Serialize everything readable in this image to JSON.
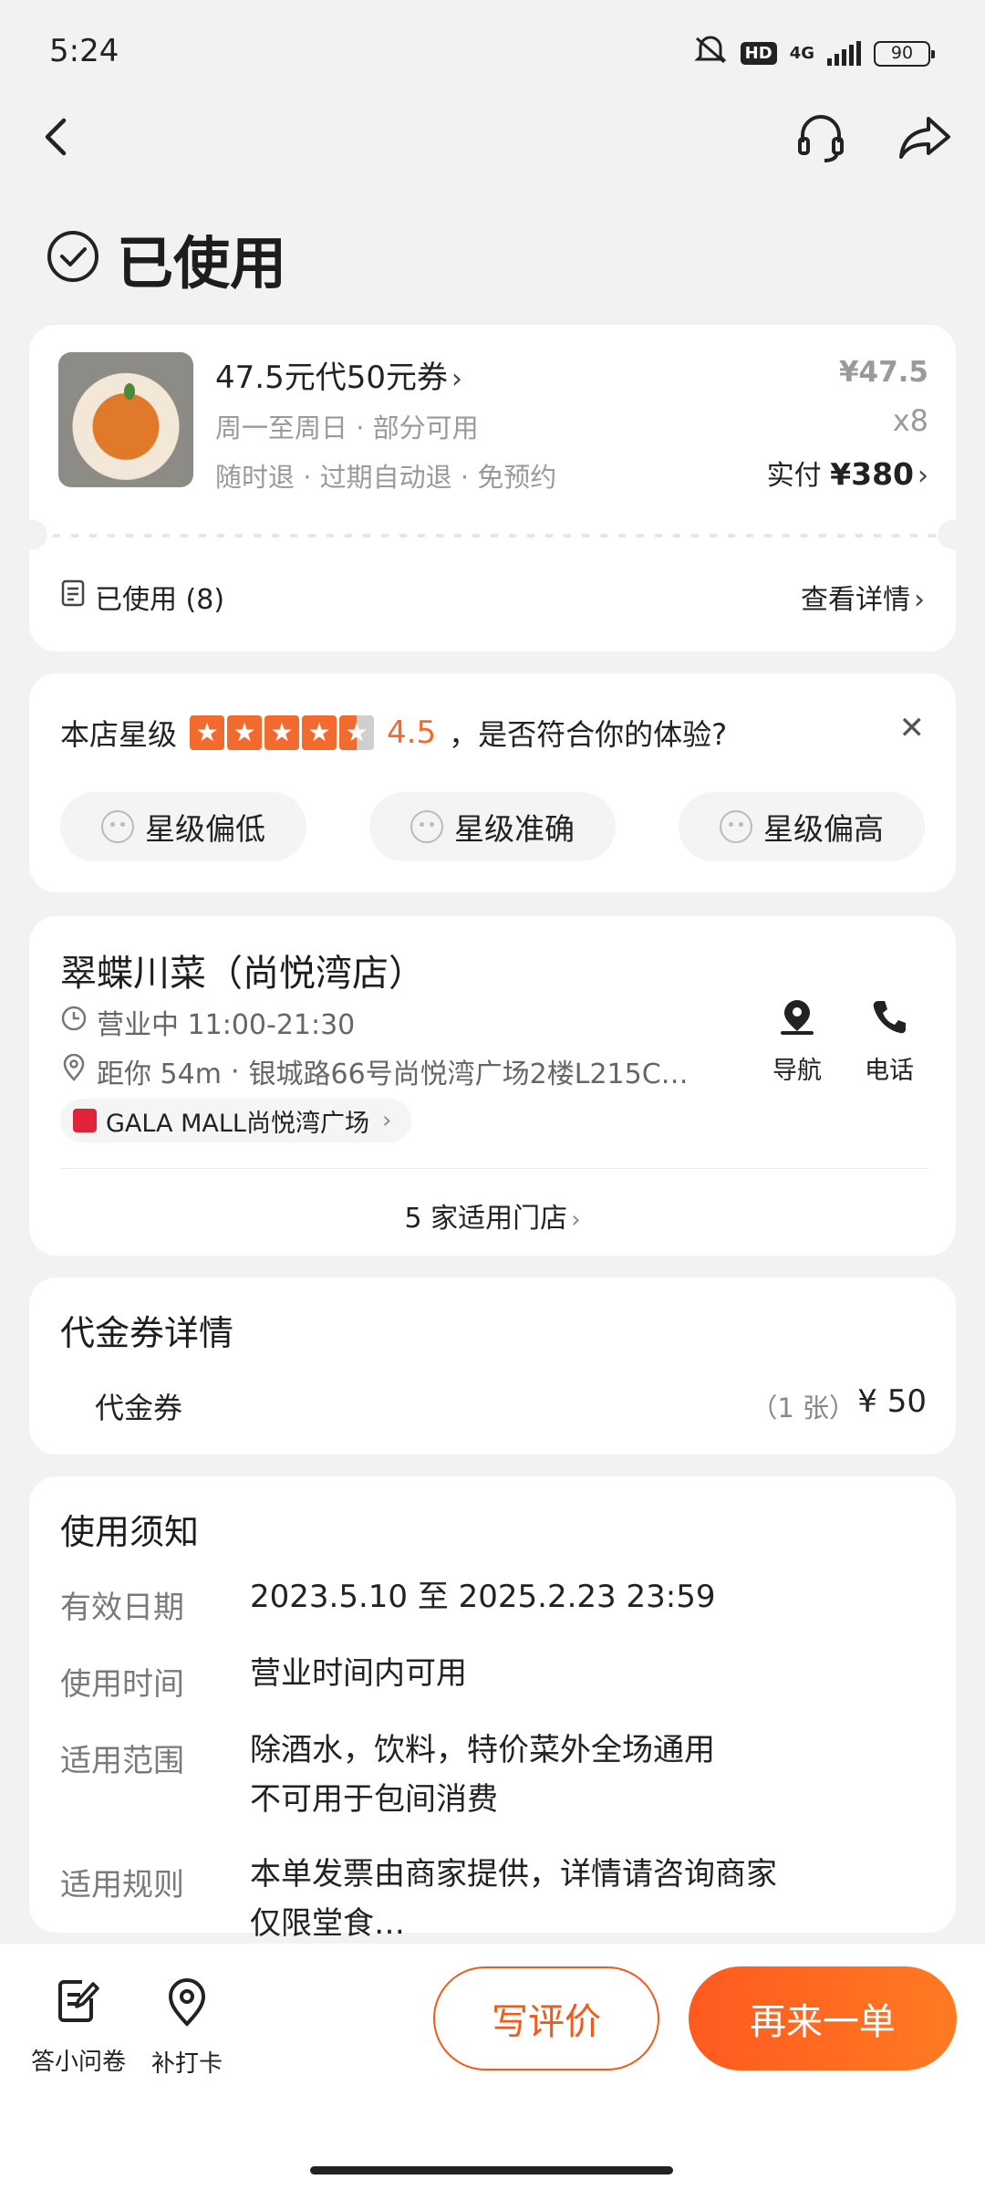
{
  "status_bar": {
    "time": "5:24",
    "network": "4G",
    "hd": "HD",
    "battery": "90"
  },
  "page": {
    "status": "已使用"
  },
  "order": {
    "title": "47.5元代50元券",
    "line1": "周一至周日 · 部分可用",
    "line2": "随时退 · 过期自动退 · 免预约",
    "unit_price": "¥47.5",
    "quantity": "x8",
    "paid_label": "实付",
    "paid_amount": "¥380",
    "used_label": "已使用 (8)",
    "detail_link": "查看详情"
  },
  "rating": {
    "prefix": "本店星级",
    "score": "4.5",
    "score_value": 4.5,
    "question": "，是否符合你的体验?",
    "options": [
      "星级偏低",
      "星级准确",
      "星级偏高"
    ]
  },
  "store": {
    "name": "翠蝶川菜（尚悦湾店）",
    "hours": "营业中 11:00-21:30",
    "distance": "距你 54m",
    "address": "银城路66号尚悦湾广场2楼L215C…",
    "nav_label": "导航",
    "phone_label": "电话",
    "mall": "GALA MALL尚悦湾广场",
    "branches": "5 家适用门店"
  },
  "voucher": {
    "title": "代金券详情",
    "name": "代金券",
    "count": "（1 张）",
    "price": "¥ 50"
  },
  "notes": {
    "title": "使用须知",
    "rows": [
      {
        "label": "有效日期",
        "value": "2023.5.10 至 2025.2.23 23:59"
      },
      {
        "label": "使用时间",
        "value": "营业时间内可用"
      },
      {
        "label": "适用范围",
        "value": "除酒水，饮料，特价菜外全场通用",
        "value2": "不可用于包间消费"
      },
      {
        "label": "适用规则",
        "value": "本单发票由商家提供，详情请咨询商家",
        "value2": "仅限堂食…"
      }
    ]
  },
  "bottom": {
    "survey": "答小问卷",
    "checkin": "补打卡",
    "review": "写评价",
    "reorder": "再来一单"
  },
  "colors": {
    "accent": "#f25a1a",
    "star": "#f26a2e"
  }
}
